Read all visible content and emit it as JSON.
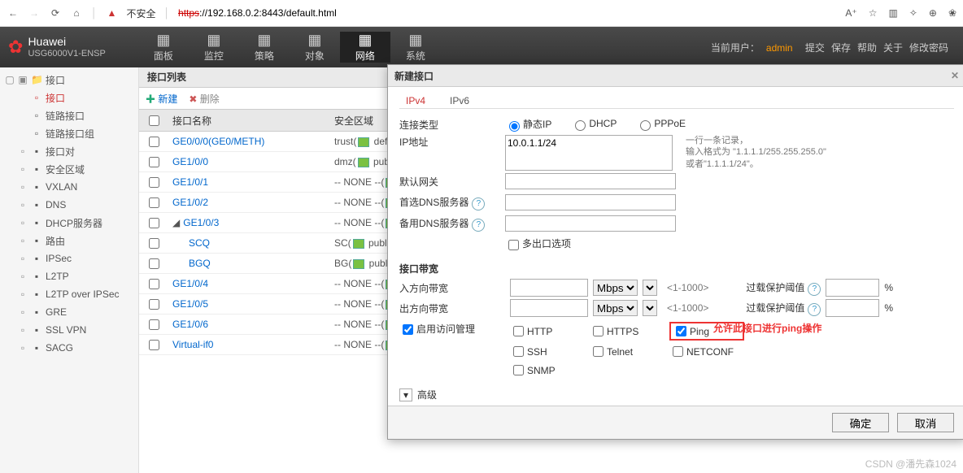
{
  "browser": {
    "insecure": "不安全",
    "proto": "https",
    "url_rest": "://192.168.0.2:8443/default.html"
  },
  "header": {
    "brand1": "Huawei",
    "brand2": "USG6000V1-ENSP",
    "nav": [
      "面板",
      "监控",
      "策略",
      "对象",
      "网络",
      "系统"
    ],
    "current_user_label": "当前用户：",
    "current_user": "admin",
    "actions": [
      "提交",
      "保存",
      "帮助",
      "关于",
      "修改密码"
    ]
  },
  "tree": {
    "root": "接口",
    "children": [
      {
        "label": "接口",
        "sel": true
      },
      {
        "label": "链路接口"
      },
      {
        "label": "链路接口组"
      }
    ],
    "others": [
      "接口对",
      "安全区域",
      "VXLAN",
      "DNS",
      "DHCP服务器",
      "路由",
      "IPSec",
      "L2TP",
      "L2TP over IPSec",
      "GRE",
      "SSL VPN",
      "SACG"
    ]
  },
  "panel": {
    "title": "接口列表",
    "btn_new": "新建",
    "btn_del": "删除",
    "col_name": "接口名称",
    "col_zone": "安全区域",
    "rows": [
      {
        "name": "GE0/0/0(GE0/METH)",
        "zone_pre": "trust(",
        "zone_post": " default)"
      },
      {
        "name": "GE1/0/0",
        "zone_pre": "dmz(",
        "zone_post": " public)"
      },
      {
        "name": "GE1/0/1",
        "zone_pre": "-- NONE --(",
        "zone_post": " publ"
      },
      {
        "name": "GE1/0/2",
        "zone_pre": "-- NONE --(",
        "zone_post": " publ"
      },
      {
        "name": "GE1/0/3",
        "zone_pre": "-- NONE --(",
        "zone_post": " publ",
        "expanded": true
      },
      {
        "name": "SCQ",
        "zone_pre": "SC(",
        "zone_post": " public)",
        "child": true
      },
      {
        "name": "BGQ",
        "zone_pre": "BG(",
        "zone_post": " public)",
        "child": true
      },
      {
        "name": "GE1/0/4",
        "zone_pre": "-- NONE --(",
        "zone_post": " publ"
      },
      {
        "name": "GE1/0/5",
        "zone_pre": "-- NONE --(",
        "zone_post": " publ"
      },
      {
        "name": "GE1/0/6",
        "zone_pre": "-- NONE --(",
        "zone_post": " publ"
      },
      {
        "name": "Virtual-if0",
        "zone_pre": "-- NONE --(",
        "zone_post": " publ"
      }
    ]
  },
  "modal": {
    "title": "新建接口",
    "conn_label": "连接类型",
    "conn_opts": [
      "静态IP",
      "DHCP",
      "PPPoE"
    ],
    "ip_label": "IP地址",
    "ip_value": "10.0.1.1/24",
    "ip_hint1": "一行一条记录，",
    "ip_hint2": "输入格式为 \"1.1.1.1/255.255.255.0\"",
    "ip_hint3": "或者\"1.1.1.1/24\"。",
    "gw_label": "默认网关",
    "dns1_label": "首选DNS服务器",
    "dns2_label": "备用DNS服务器",
    "multi_label": "多出口选项",
    "band_section": "接口带宽",
    "in_label": "入方向带宽",
    "out_label": "出方向带宽",
    "unit": "Mbps",
    "range": "<1-1000>",
    "overload": "过载保护阈值",
    "pct": "%",
    "access_label": "启用访问管理",
    "access_opts": [
      "HTTP",
      "HTTPS",
      "Ping",
      "SSH",
      "Telnet",
      "NETCONF",
      "SNMP"
    ],
    "annot": "允许此接口进行ping操作",
    "adv": "高级",
    "ok": "确定",
    "cancel": "取消"
  },
  "watermark": "CSDN @潘先森1024"
}
